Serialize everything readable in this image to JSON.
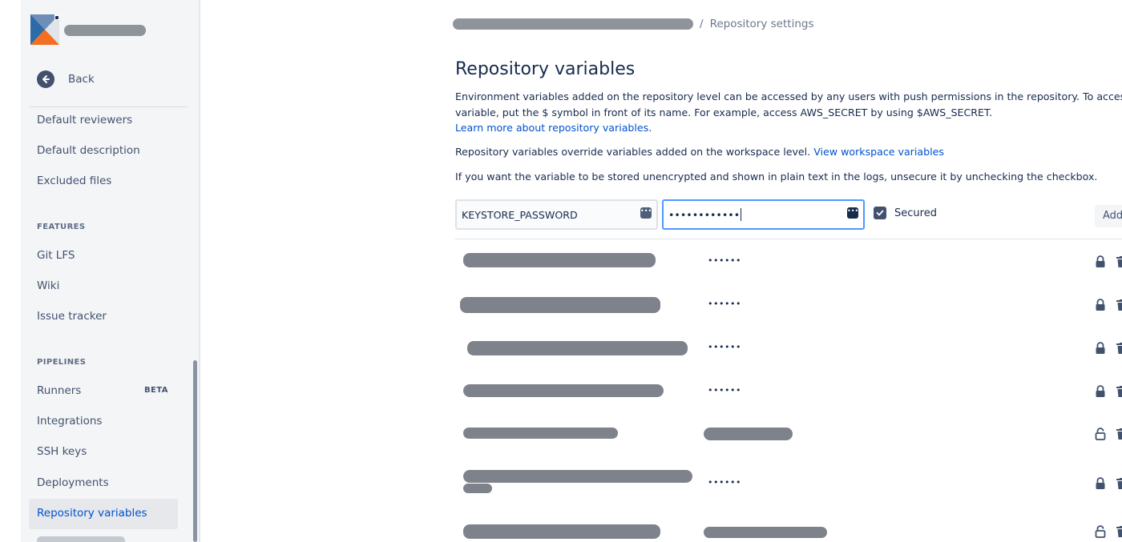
{
  "sidebar": {
    "back_label": "Back",
    "items_general": [
      {
        "label": "Default reviewers"
      },
      {
        "label": "Default description"
      },
      {
        "label": "Excluded files"
      }
    ],
    "features_heading": "FEATURES",
    "items_features": [
      {
        "label": "Git LFS"
      },
      {
        "label": "Wiki"
      },
      {
        "label": "Issue tracker"
      }
    ],
    "pipelines_heading": "PIPELINES",
    "items_pipelines": [
      {
        "label": "Runners",
        "badge": "BETA"
      },
      {
        "label": "Integrations"
      },
      {
        "label": "SSH keys"
      },
      {
        "label": "Deployments"
      },
      {
        "label": "Repository variables",
        "active": true
      }
    ]
  },
  "breadcrumb": {
    "separator": "/",
    "current": "Repository settings"
  },
  "page": {
    "title": "Repository variables",
    "desc_line1": "Environment variables added on the repository level can be accessed by any users with push permissions in the repository. To access a",
    "desc_line2": "variable, put the $ symbol in front of its name. For example, access AWS_SECRET by using $AWS_SECRET.",
    "learn_more_link": "Learn more about repository variables",
    "learn_more_suffix": ".",
    "override_text": "Repository variables override variables added on the workspace level.",
    "workspace_link": "View workspace variables",
    "unsecure_text": "If you want the variable to be stored unencrypted and shown in plain text in the logs, unsecure it by unchecking the checkbox."
  },
  "form": {
    "name_value": "KEYSTORE_PASSWORD",
    "value_masked": "••••••••••••",
    "secured_label": "Secured",
    "secured_checked": true,
    "add_label": "Add"
  },
  "variables": [
    {
      "value_display": "••••••",
      "secured": true
    },
    {
      "value_display": "••••••",
      "secured": true
    },
    {
      "value_display": "••••••",
      "secured": true
    },
    {
      "value_display": "••••••",
      "secured": true
    },
    {
      "value_display": "",
      "secured": false
    },
    {
      "value_display": "••••••",
      "secured": true
    },
    {
      "value_display": "",
      "secured": false
    }
  ],
  "colors": {
    "accent": "#0052cc",
    "focus_border": "#4c9aff",
    "text_primary": "#172b4d",
    "text_secondary": "#42526e"
  }
}
